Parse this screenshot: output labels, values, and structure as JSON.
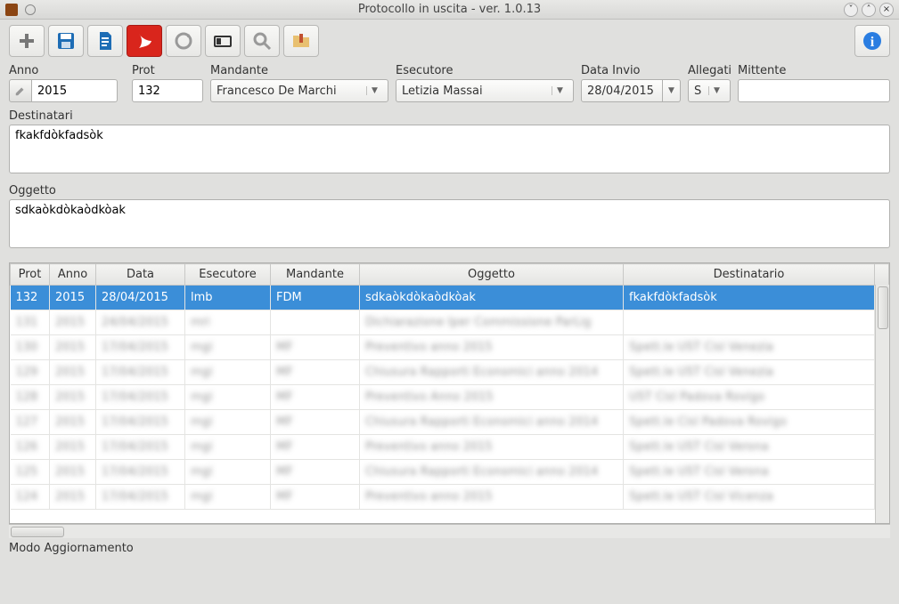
{
  "window": {
    "title": "Protocollo in uscita - ver. 1.0.13"
  },
  "toolbar": {
    "icons": [
      "add",
      "save",
      "document",
      "pdf",
      "refresh",
      "card",
      "search",
      "folder",
      "info"
    ]
  },
  "form": {
    "anno": {
      "label": "Anno",
      "value": "2015"
    },
    "prot": {
      "label": "Prot",
      "value": "132"
    },
    "mandante": {
      "label": "Mandante",
      "value": "Francesco De Marchi"
    },
    "esecutore": {
      "label": "Esecutore",
      "value": "Letizia Massai"
    },
    "data_invio": {
      "label": "Data Invio",
      "value": "28/04/2015"
    },
    "allegati": {
      "label": "Allegati",
      "value": "S"
    },
    "mittente": {
      "label": "Mittente",
      "value": ""
    }
  },
  "destinatari": {
    "label": "Destinatari",
    "value": "fkakfdòkfadsòk"
  },
  "oggetto": {
    "label": "Oggetto",
    "value": "sdkaòkdòkaòdkòak"
  },
  "table": {
    "headers": {
      "prot": "Prot",
      "anno": "Anno",
      "data": "Data",
      "esecutore": "Esecutore",
      "mandante": "Mandante",
      "oggetto": "Oggetto",
      "destinatario": "Destinatario"
    },
    "rows": [
      {
        "prot": "132",
        "anno": "2015",
        "data": "28/04/2015",
        "esecutore": "lmb",
        "mandante": "FDM",
        "oggetto": "sdkaòkdòkaòdkòak",
        "destinatario": "fkakfdòkfadsòk",
        "selected": true
      },
      {
        "prot": "131",
        "anno": "2015",
        "data": "24/04/2015",
        "esecutore": "mri",
        "mandante": "",
        "oggetto": "Dichiarazione Iper Commissione ParLig",
        "destinatario": "",
        "blurred": true
      },
      {
        "prot": "130",
        "anno": "2015",
        "data": "17/04/2015",
        "esecutore": "mgi",
        "mandante": "MF",
        "oggetto": "Preventivo anno 2015",
        "destinatario": "Spett.le UST Cisl Venezia",
        "blurred": true
      },
      {
        "prot": "129",
        "anno": "2015",
        "data": "17/04/2015",
        "esecutore": "mgi",
        "mandante": "MF",
        "oggetto": "Chiusura Rapporti Economici anno 2014",
        "destinatario": "Spett.le UST Cisl Venezia",
        "blurred": true
      },
      {
        "prot": "128",
        "anno": "2015",
        "data": "17/04/2015",
        "esecutore": "mgi",
        "mandante": "MF",
        "oggetto": "Preventivo Anno 2015",
        "destinatario": "UST Cisl Padova Rovigo",
        "blurred": true
      },
      {
        "prot": "127",
        "anno": "2015",
        "data": "17/04/2015",
        "esecutore": "mgi",
        "mandante": "MF",
        "oggetto": "Chiusura Rapporti Economici anno 2014",
        "destinatario": "Spett.le Cisl Padova Rovigo",
        "blurred": true
      },
      {
        "prot": "126",
        "anno": "2015",
        "data": "17/04/2015",
        "esecutore": "mgi",
        "mandante": "MF",
        "oggetto": "Preventivo anno 2015",
        "destinatario": "Spett.le UST Cisl Verona",
        "blurred": true
      },
      {
        "prot": "125",
        "anno": "2015",
        "data": "17/04/2015",
        "esecutore": "mgi",
        "mandante": "MF",
        "oggetto": "Chiusura Rapporti Economici anno 2014",
        "destinatario": "Spett.le UST Cisl Verona",
        "blurred": true
      },
      {
        "prot": "124",
        "anno": "2015",
        "data": "17/04/2015",
        "esecutore": "mgi",
        "mandante": "MF",
        "oggetto": "Preventivo anno 2015",
        "destinatario": "Spett.le UST Cisl Vicenza",
        "blurred": true
      }
    ]
  },
  "status": "Modo Aggiornamento"
}
